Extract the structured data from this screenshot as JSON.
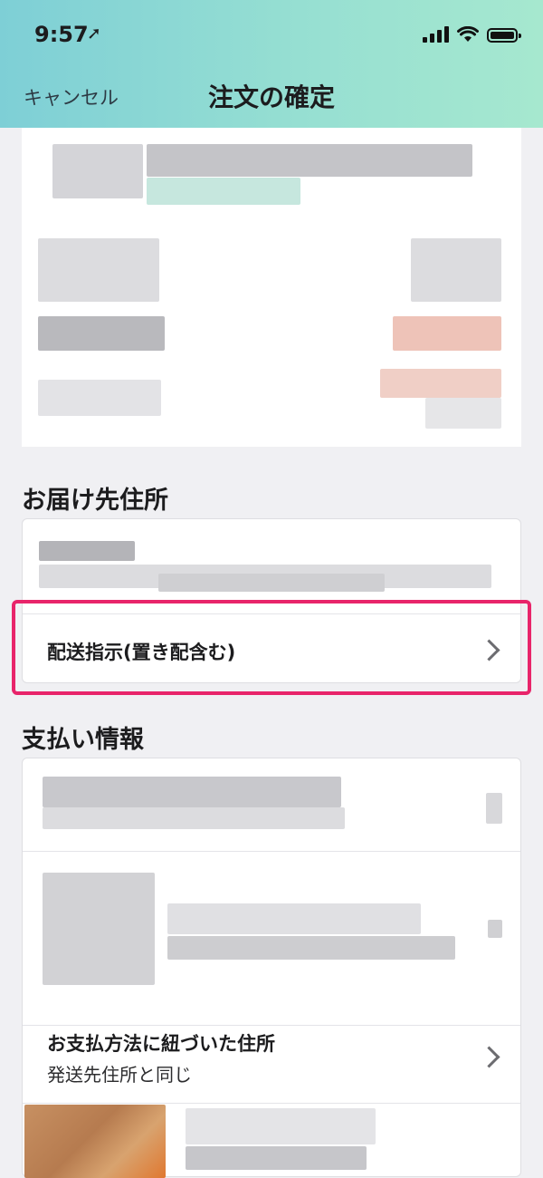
{
  "status_bar": {
    "time": "9:57"
  },
  "nav": {
    "cancel_label": "キャンセル",
    "title": "注文の確定"
  },
  "sections": {
    "shipping": {
      "title": "お届け先住所",
      "delivery_instruction_label": "配送指示(置き配含む)"
    },
    "payment": {
      "title": "支払い情報",
      "billing_address_label": "お支払方法に紐づいた住所",
      "billing_address_value": "発送先住所と同じ"
    }
  },
  "colors": {
    "header_start": "#7ecfd6",
    "header_end": "#a6e8cf",
    "highlight": "#e8246a",
    "background": "#f0f0f3"
  }
}
